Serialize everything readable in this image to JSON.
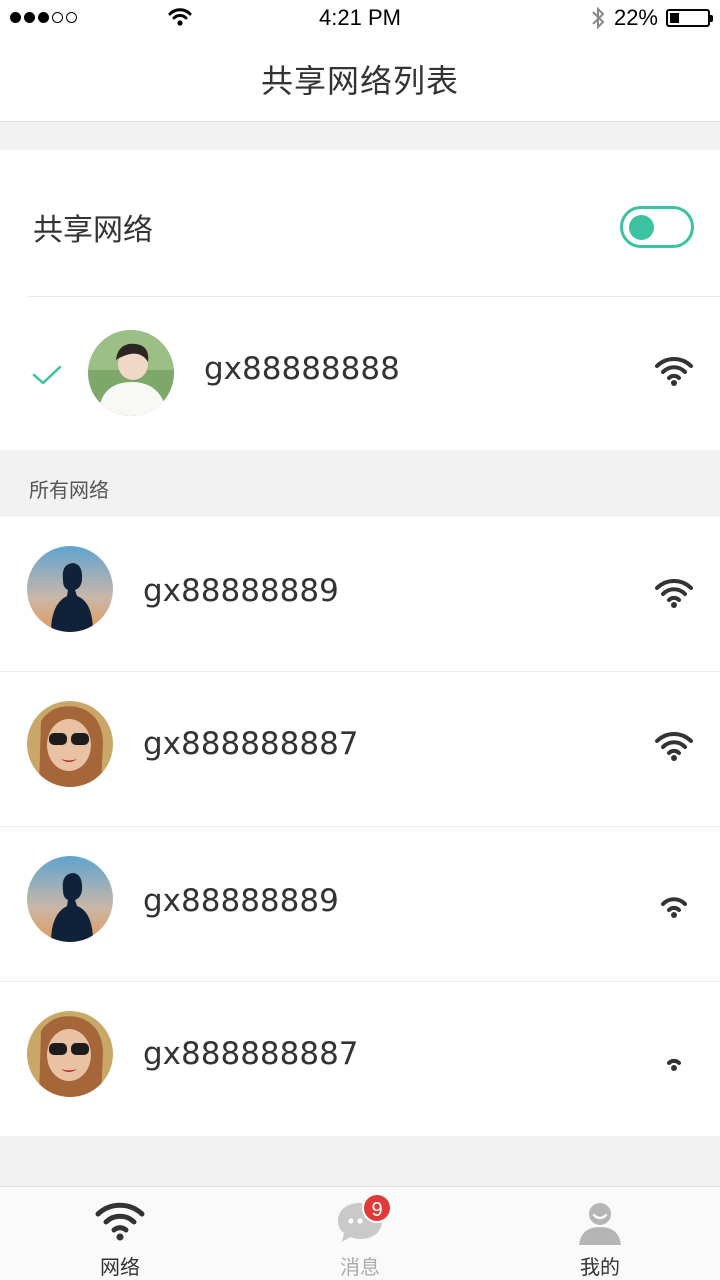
{
  "status_bar": {
    "time": "4:21 PM",
    "battery": "22%",
    "signal_bars_filled": 3,
    "signal_bars_total": 5,
    "battery_level": 0.22
  },
  "nav": {
    "title": "共享网络列表"
  },
  "share": {
    "label": "共享网络",
    "toggle_on": true,
    "accent_color": "#3cc2a0"
  },
  "connected": {
    "ssid": "gx88888888",
    "signal_level": 3,
    "avatar": "avatar-boy-icon"
  },
  "all_networks": {
    "title": "所有网络",
    "items": [
      {
        "ssid": "gx88888889",
        "signal_level": 3,
        "avatar": "avatar-silhouette-icon"
      },
      {
        "ssid": "gx888888887",
        "signal_level": 3,
        "avatar": "avatar-sunglasses-icon"
      },
      {
        "ssid": "gx88888889",
        "signal_level": 2,
        "avatar": "avatar-silhouette-icon"
      },
      {
        "ssid": "gx888888887",
        "signal_level": 1,
        "avatar": "avatar-sunglasses-icon"
      }
    ]
  },
  "tabs": [
    {
      "label": "网络",
      "icon": "wifi-icon",
      "active": true
    },
    {
      "label": "消息",
      "icon": "chat-bubble-icon",
      "badge": "9"
    },
    {
      "label": "我的",
      "icon": "person-icon"
    }
  ]
}
